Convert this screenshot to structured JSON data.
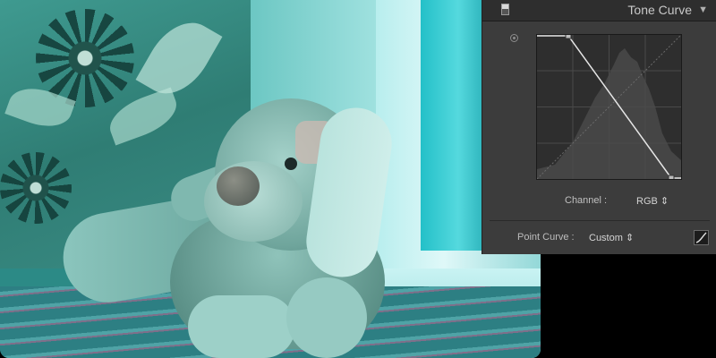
{
  "panel": {
    "title": "Tone Curve",
    "collapse_icon": "triangle-down-icon",
    "switch_icon": "panel-switch-icon",
    "target_icon": "target-adjust-icon",
    "channel_label": "Channel :",
    "channel_value": "RGB ⇕",
    "point_curve_label": "Point Curve :",
    "point_curve_value": "Custom ⇕",
    "point_curve_icon": "edit-point-curve-icon",
    "colors": {
      "panel_bg": "#3c3c3c",
      "header_bg": "#2e2e2e",
      "curve_bg": "#2e2e2e",
      "curve_line": "#e6e6e6"
    }
  }
}
